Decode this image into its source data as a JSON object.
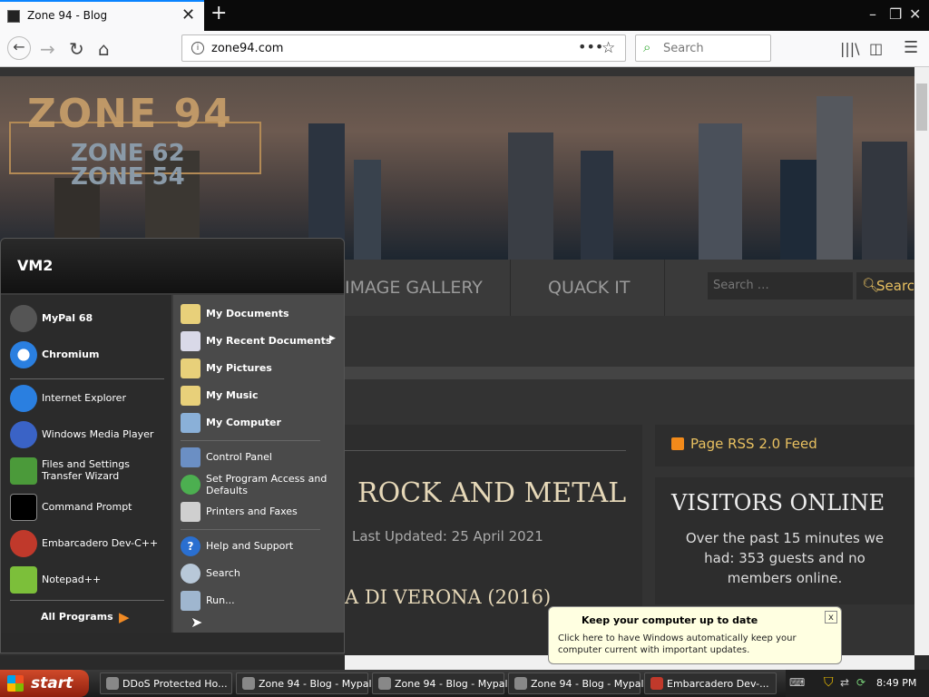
{
  "browser": {
    "tab_title": "Zone 94 - Blog",
    "url": "zone94.com",
    "search_placeholder": "Search"
  },
  "website": {
    "logo_main": "ZONE 94",
    "logo_sub1": "ZONE 62",
    "logo_sub2": "ZONE 54",
    "nav": [
      "IMAGE GALLERY",
      "QUACK IT"
    ],
    "search_placeholder": "Search …",
    "search_button": "Search",
    "article_title": "ROCK AND METAL",
    "last_updated": "Last Updated: 25 April 2021",
    "sub_heading": "A DI VERONA (2016)",
    "rss_label": "Page RSS 2.0 Feed",
    "visitors_title": "VISITORS ONLINE",
    "visitors_text": "Over the past 15 minutes we had: 353 guests and no members online."
  },
  "start_menu": {
    "user": "VM2",
    "pinned": [
      "MyPal 68",
      "Chromium"
    ],
    "recent": [
      "Internet Explorer",
      "Windows Media Player",
      "Files and Settings Transfer Wizard",
      "Command Prompt",
      "Embarcadero Dev-C++",
      "Notepad++"
    ],
    "all_programs": "All Programs",
    "places": [
      "My Documents",
      "My Recent Documents",
      "My Pictures",
      "My Music",
      "My Computer"
    ],
    "system": [
      "Control Panel",
      "Set Program Access and Defaults",
      "Printers and Faxes"
    ],
    "help": [
      "Help and Support",
      "Search",
      "Run..."
    ]
  },
  "notification": {
    "title": "Keep your computer up to date",
    "body": "Click here to have Windows automatically keep your computer current with important updates.",
    "close": "x"
  },
  "taskbar": {
    "start": "start",
    "items": [
      "DDoS Protected Ho...",
      "Zone 94 - Blog - Mypal",
      "Zone 94 - Blog - Mypal",
      "Zone 94 - Blog - Mypal",
      "Embarcadero Dev-..."
    ],
    "clock": "8:49 PM"
  },
  "colors": {
    "accent_firefox": "#0a84ff",
    "start_button": "#c0391b",
    "balloon_bg": "#ffffe1",
    "site_link": "#e8c060"
  },
  "icons": [
    "back-icon",
    "forward-icon",
    "reload-icon",
    "home-icon",
    "info-icon",
    "more-icon",
    "star-icon",
    "library-icon",
    "sidebar-icon",
    "hamburger-icon",
    "rss-icon",
    "search-icon"
  ]
}
